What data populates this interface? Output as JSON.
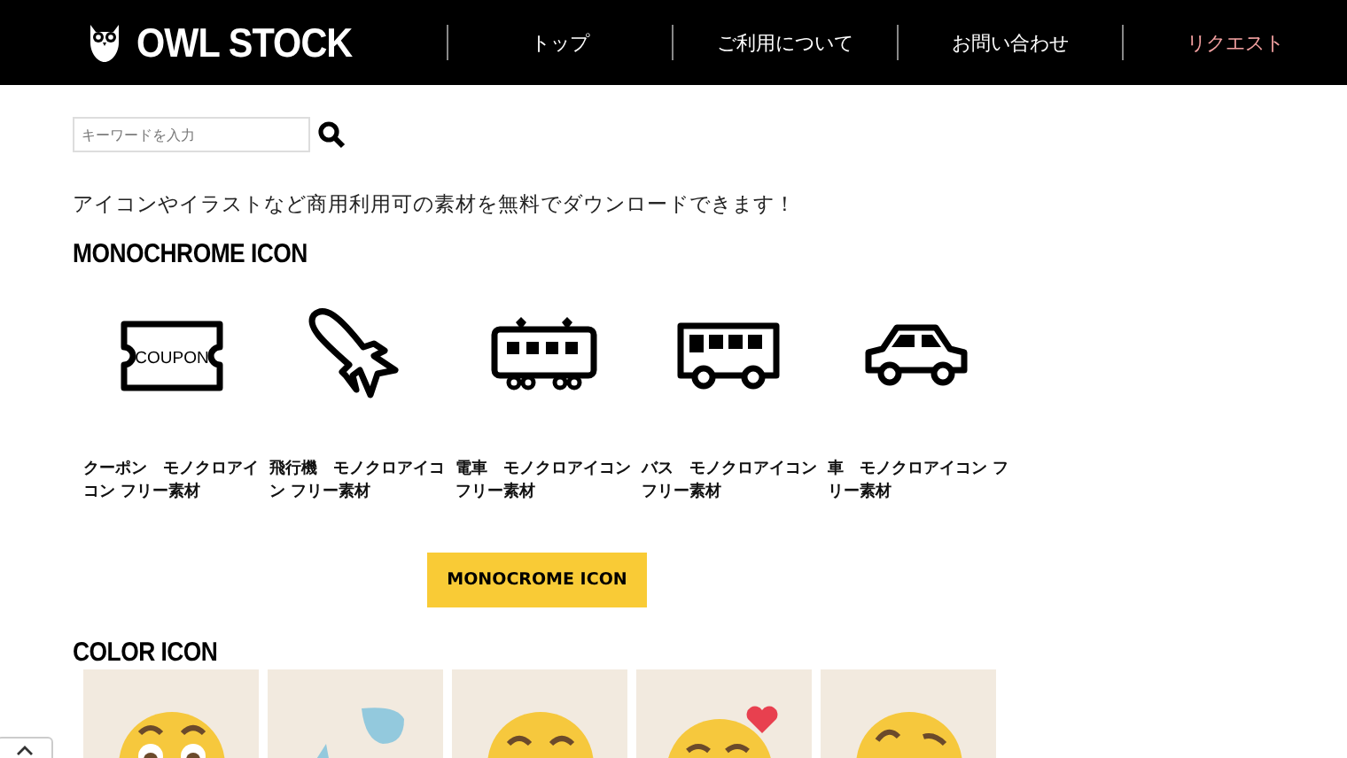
{
  "header": {
    "logo": "OWL STOCK",
    "nav": [
      {
        "label": "トップ",
        "selected": false
      },
      {
        "label": "ご利用について",
        "selected": false
      },
      {
        "label": "お問い合わせ",
        "selected": false
      },
      {
        "label": "リクエスト",
        "selected": true
      }
    ]
  },
  "search": {
    "placeholder": "キーワードを入力"
  },
  "tagline": "アイコンやイラストなど商用利用可の素材を無料でダウンロードできます！",
  "monochrome": {
    "heading": "MONOCHROME ICON",
    "items": [
      {
        "kind": "coupon",
        "icon_text": "COUPON",
        "caption": "クーポン　モノクロアイコン フリー素材"
      },
      {
        "kind": "plane",
        "caption": "飛行機　モノクロアイコン フリー素材"
      },
      {
        "kind": "train",
        "caption": "電車　モノクロアイコンフリー素材"
      },
      {
        "kind": "bus",
        "caption": "バス　モノクロアイコンフリー素材"
      },
      {
        "kind": "car",
        "caption": "車　モノクロアイコン フリー素材"
      }
    ],
    "button": "MONOCROME ICON"
  },
  "color": {
    "heading": "COLOR ICON",
    "items": [
      {
        "kind": "surprised"
      },
      {
        "kind": "drop"
      },
      {
        "kind": "smile"
      },
      {
        "kind": "heart"
      },
      {
        "kind": "wink"
      }
    ]
  }
}
